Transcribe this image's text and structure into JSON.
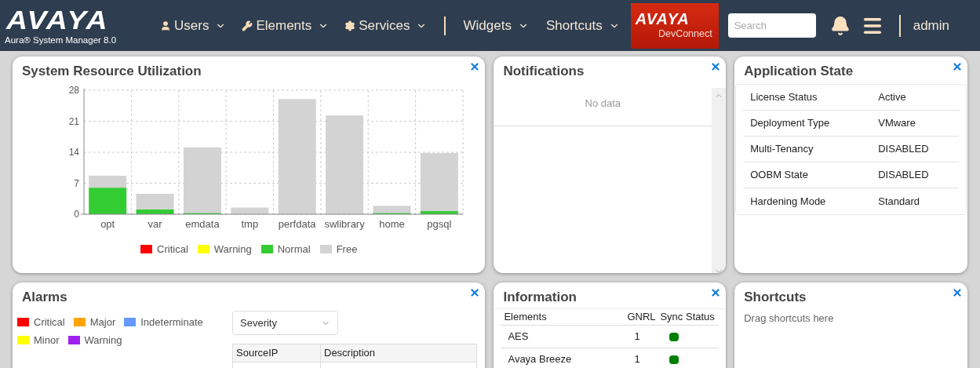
{
  "header": {
    "logo": "AVAYA",
    "product": "Aura® System Manager 8.0",
    "menus": [
      {
        "label": "Users"
      },
      {
        "label": "Elements"
      },
      {
        "label": "Services"
      }
    ],
    "menus_right": [
      {
        "label": "Widgets"
      },
      {
        "label": "Shortcuts"
      }
    ],
    "badge": {
      "brand": "AVAYA",
      "label": "DevConnect"
    },
    "search": {
      "placeholder": "Search"
    },
    "user": "admin"
  },
  "resource_widget": {
    "title": "System Resource Utilization",
    "chart_data": {
      "type": "bar",
      "stacked": true,
      "grid": true,
      "legend": true,
      "categories": [
        "opt",
        "var",
        "emdata",
        "tmp",
        "perfdata",
        "swlibrary",
        "home",
        "pgsql"
      ],
      "ylim": [
        0,
        28
      ],
      "yticks": [
        0,
        7,
        14,
        21,
        28
      ],
      "series": [
        {
          "name": "Critical",
          "color": "#ff0000",
          "values": [
            0,
            0,
            0,
            0,
            0,
            0,
            0,
            0
          ]
        },
        {
          "name": "Warning",
          "color": "#ffff00",
          "values": [
            0,
            0,
            0,
            0,
            0,
            0,
            0,
            0
          ]
        },
        {
          "name": "Normal",
          "color": "#33cc33",
          "values": [
            6,
            1.1,
            0.3,
            0,
            0,
            0,
            0.3,
            0.7
          ]
        },
        {
          "name": "Free",
          "color": "#d3d3d3",
          "values": [
            2.7,
            3.5,
            14.8,
            1.5,
            26,
            22.3,
            1.6,
            13.1
          ]
        }
      ]
    }
  },
  "notifications": {
    "title": "Notifications",
    "empty": "No data"
  },
  "application_state": {
    "title": "Application State",
    "rows": [
      {
        "label": "License Status",
        "value": "Active"
      },
      {
        "label": "Deployment Type",
        "value": "VMware"
      },
      {
        "label": "Multi-Tenancy",
        "value": "DISABLED"
      },
      {
        "label": "OOBM State",
        "value": "DISABLED"
      },
      {
        "label": "Hardening Mode",
        "value": "Standard"
      }
    ]
  },
  "alarms": {
    "title": "Alarms",
    "legend": [
      {
        "label": "Critical",
        "color": "#ff0000"
      },
      {
        "label": "Major",
        "color": "#ffa500"
      },
      {
        "label": "Indeterminate",
        "color": "#6699ff"
      },
      {
        "label": "Minor",
        "color": "#ffff00"
      },
      {
        "label": "Warning",
        "color": "#a020f0"
      }
    ],
    "filter": {
      "value": "Severity"
    },
    "columns": [
      "SourceIP",
      "Description"
    ]
  },
  "information": {
    "title": "Information",
    "columns": [
      "Elements",
      "GNRL",
      "Sync Status"
    ],
    "rows": [
      {
        "element": "AES",
        "gnrl": "1",
        "color": "#008000"
      },
      {
        "element": "Avaya Breeze",
        "gnrl": "1",
        "color": "#008000"
      }
    ]
  },
  "shortcuts": {
    "title": "Shortcuts",
    "hint": "Drag shortcuts here"
  }
}
